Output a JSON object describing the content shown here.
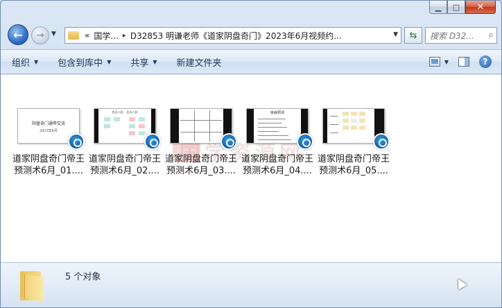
{
  "window": {
    "caption": {
      "minimize_glyph": "▁",
      "maximize_glyph": "□",
      "close_glyph": "✕"
    }
  },
  "nav": {
    "back_glyph": "←",
    "forward_glyph": "→",
    "dropdown_glyph": "▼",
    "breadcrumb_prefix": "«",
    "breadcrumb": [
      "国学...",
      "D32853 明谦老师《道家阴盘奇门》2023年6月视频约..."
    ],
    "crumb_separator": "▸",
    "address_dropdown_glyph": "▼",
    "refresh_glyph": "⇆",
    "search_placeholder": "搜索 D32...",
    "search_icon_glyph": "⌕"
  },
  "toolbar": {
    "items": [
      {
        "label": "组织",
        "caret": "▼"
      },
      {
        "label": "包含到库中",
        "caret": "▼"
      },
      {
        "label": "共享",
        "caret": "▼"
      },
      {
        "label": "新建文件夹",
        "caret": ""
      }
    ],
    "view_caret": "▼",
    "help_glyph": "?"
  },
  "files": [
    {
      "name_line1": "道家阴盘奇门帝王",
      "name_line2": "预测术6月_01....",
      "thumb_title": "阴盘奇门通甲交流",
      "thumb_sub": "2023年6月"
    },
    {
      "name_line1": "道家阴盘奇门帝王",
      "name_line2": "预测术6月_02....",
      "thumb_title": "先天八卦    后天八卦",
      "thumb_sub": ""
    },
    {
      "name_line1": "道家阴盘奇门帝王",
      "name_line2": "预测术6月_03....",
      "thumb_title": "",
      "thumb_sub": ""
    },
    {
      "name_line1": "道家阴盘奇门帝王",
      "name_line2": "预测术6月_04....",
      "thumb_title": "疾病预测",
      "thumb_sub": ""
    },
    {
      "name_line1": "道家阴盘奇门帝王",
      "name_line2": "预测术6月_05....",
      "thumb_title": "",
      "thumb_sub": ""
    }
  ],
  "watermark": "国学资源网",
  "status": {
    "count_text": "5 个对象"
  }
}
